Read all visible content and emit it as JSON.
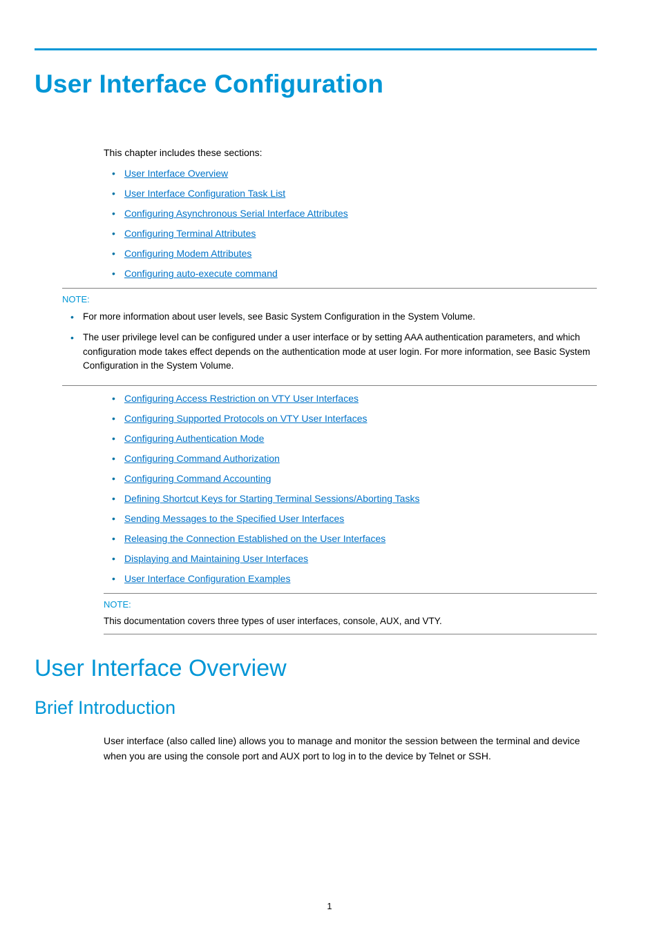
{
  "mainTitle": "User Interface Configuration",
  "introText": "This chapter includes these sections:",
  "topLinks": [
    "User Interface Overview",
    "User Interface Configuration Task List",
    "Configuring Asynchronous Serial Interface Attributes",
    "Configuring Terminal Attributes",
    "Configuring Modem Attributes",
    "Configuring auto-execute command"
  ],
  "note1": {
    "label": "NOTE:",
    "items": [
      "For more information about user levels, see Basic System Configuration in the System Volume.",
      "The user privilege level can be configured under a user interface or by setting AAA authentication parameters, and which configuration mode takes effect depends on the authentication mode at user login. For more information, see Basic System Configuration in the System Volume."
    ]
  },
  "midLinks": [
    "Configuring Access Restriction on VTY User Interfaces",
    "Configuring Supported Protocols on VTY User Interfaces",
    "Configuring Authentication Mode",
    "Configuring Command Authorization",
    "Configuring Command Accounting",
    "Defining Shortcut Keys for Starting Terminal Sessions/Aborting Tasks",
    "Sending Messages to the Specified User Interfaces",
    "Releasing the Connection Established on the User Interfaces",
    "Displaying and Maintaining User Interfaces",
    "User Interface Configuration Examples"
  ],
  "note2": {
    "label": "NOTE:",
    "text": "This documentation covers three types of user interfaces, console, AUX, and VTY."
  },
  "sectionTitle": "User Interface Overview",
  "subTitle": "Brief Introduction",
  "bodyText": "User interface (also called line) allows you to manage and monitor the session between the terminal and device when you are using the console port and AUX port to log in to the device by Telnet or SSH.",
  "pageNumber": "1"
}
